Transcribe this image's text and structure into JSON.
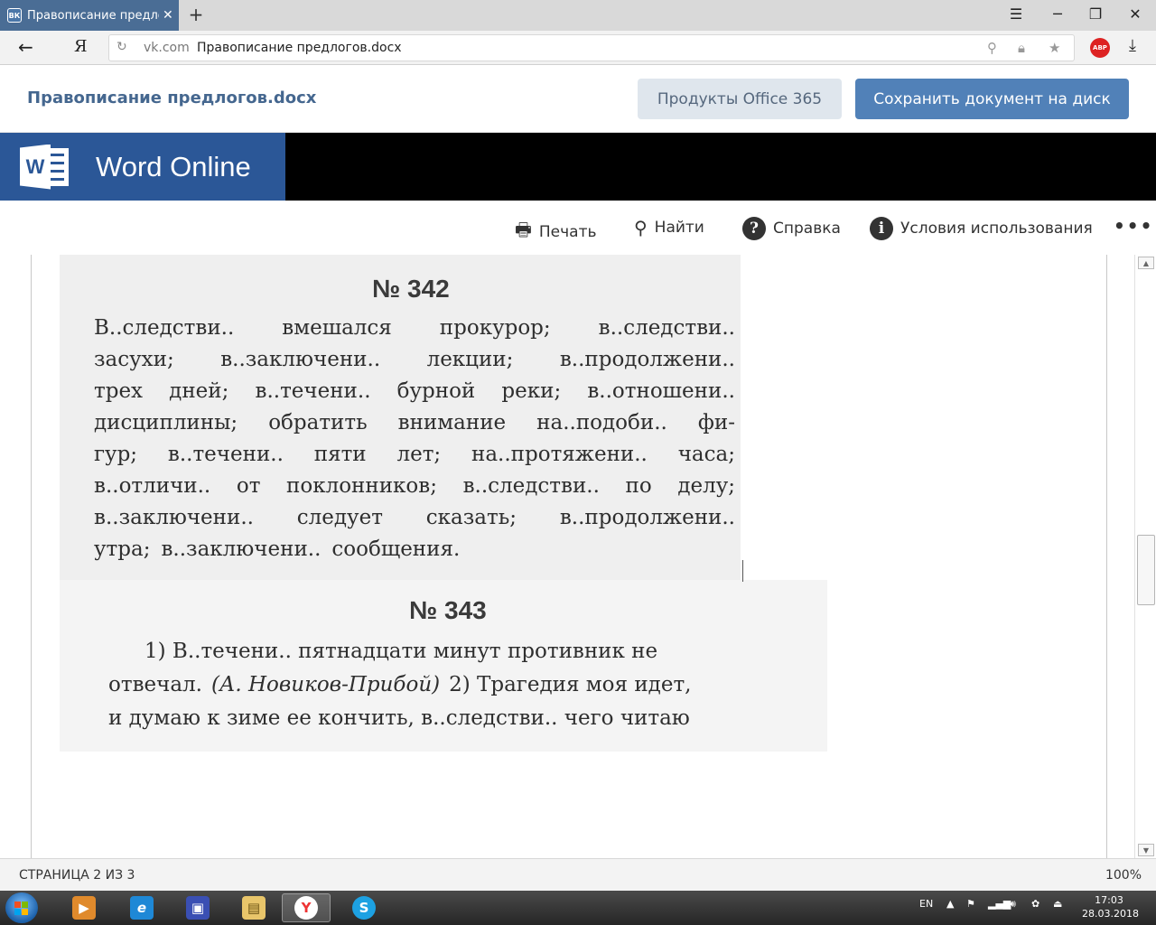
{
  "browser": {
    "tab_title": "Правописание предлогов.docx",
    "tab_favicon": "ВК",
    "close_glyph": "✕",
    "new_tab_glyph": "+",
    "yandex_logo": "Я",
    "domain": "vk.com",
    "page_title": "Правописание предлогов.docx",
    "adblock_label": "ABP"
  },
  "vk_header": {
    "doc_title": "Правописание предлогов.docx",
    "office_button": "Продукты Office 365",
    "save_button": "Сохранить документ на диск"
  },
  "word_bar": {
    "logo_letter": "W",
    "app_title": "Word Online",
    "brand_color": "#2b5797"
  },
  "toolbar": {
    "print": "Печать",
    "find": "Найти",
    "help": "Справка",
    "help_glyph": "?",
    "terms": "Условия использования",
    "terms_glyph": "i",
    "more": "•••"
  },
  "document": {
    "ex1_number": "№ 342",
    "ex1_lines": [
      [
        "В..следстви..",
        "вмешался",
        "прокурор;",
        "в..следстви.."
      ],
      [
        "засухи;",
        "в..заключени..",
        "лекции;",
        "в..продолжени.."
      ],
      [
        "трех",
        "дней;",
        "в..течени..",
        "бурной",
        "реки;",
        "в..отношени.."
      ],
      [
        "дисциплины;",
        "обратить",
        "внимание",
        "на..подоби..",
        "фи-"
      ],
      [
        "гур;",
        "в..течени..",
        "пяти",
        "лет;",
        "на..протяжени..",
        "часа;"
      ],
      [
        "в..отличи..",
        "от",
        "поклонников;",
        "в..следстви..",
        "по",
        "делу;"
      ],
      [
        "в..заключени..",
        "следует",
        "сказать;",
        "в..продолжени.."
      ],
      [
        "утра;",
        "в..заключени..",
        "сообщения."
      ]
    ],
    "ex2_number": "№ 343",
    "ex2_line1": "1) В..течени.. пятнадцати минут противник не",
    "ex2_line2_a": "отвечал.",
    "ex2_line2_b": "(А. Новиков-Прибой)",
    "ex2_line2_c": "2) Трагедия моя идет,",
    "ex2_line3": "и думаю к зиме ее кончить, в..следстви.. чего читаю"
  },
  "status_bar": {
    "page_info": "СТРАНИЦА 2 ИЗ 3",
    "zoom": "100%"
  },
  "taskbar": {
    "lang": "EN",
    "time": "17:03",
    "date": "28.03.2018",
    "yandex_glyph": "Y",
    "skype_glyph": "S"
  }
}
